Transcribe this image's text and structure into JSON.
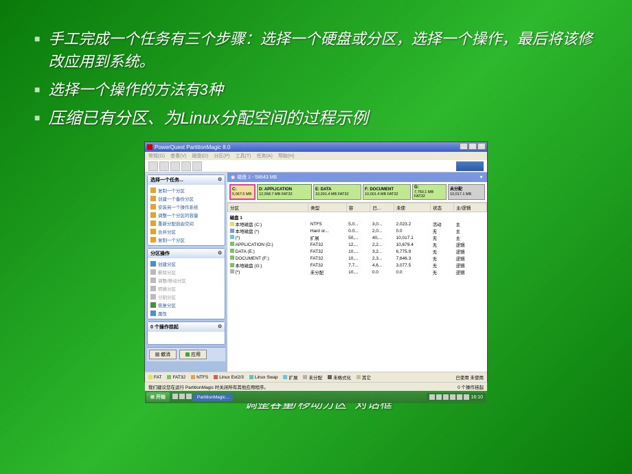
{
  "bullets": [
    "手工完成一个任务有三个步骤：选择一个硬盘或分区，选择一个操作，最后将该修改应用到系统。",
    "选择一个操作的方法有3种",
    "压缩已有分区、为Linux分配空间的过程示例"
  ],
  "caption": "\"调整容量/移动分区\" 对话框",
  "app": {
    "title": "PowerQuest PartitionMagic 8.0",
    "menu": [
      "常规(G)",
      "查看(V)",
      "磁盘(D)",
      "分区(P)",
      "工具(T)",
      "任务(A)",
      "帮助(H)"
    ],
    "disk_label": "磁盘 1 - 58643 MB"
  },
  "sidebar": {
    "tasks": {
      "title": "选择一个任务...",
      "items": [
        "复制一个分区",
        "创建一个备份分区",
        "安装另一个操作系统",
        "调整一个分区的容量",
        "重新分配自由空间",
        "合并分区",
        "复制一个分区"
      ]
    },
    "ops": {
      "title": "分区操作",
      "items": [
        {
          "label": "创建分区",
          "enabled": true
        },
        {
          "label": "删除分区",
          "enabled": false
        },
        {
          "label": "调整/移动分区",
          "enabled": false
        },
        {
          "label": "转换分区",
          "enabled": false
        },
        {
          "label": "分割分区",
          "enabled": false
        },
        {
          "label": "恢复分区",
          "enabled": true
        },
        {
          "label": "属性",
          "enabled": true
        }
      ]
    },
    "pending": {
      "title": "0 个操作挂起"
    },
    "buttons": {
      "undo": "撤消",
      "apply": "应用"
    }
  },
  "partitions": [
    {
      "name": "C:",
      "size": "5,067.5 MB",
      "fs": ""
    },
    {
      "name": "D: APPLICATION",
      "size": "12,958.7 MB",
      "fs": "FAT32"
    },
    {
      "name": "E: DATA",
      "size": "10,001.4 MB",
      "fs": "FAT32"
    },
    {
      "name": "F: DOCUMENT",
      "size": "10,001.4 MB",
      "fs": "FAT32"
    },
    {
      "name": "G:",
      "size": "7,750.1 MB",
      "fs": "FAT32"
    },
    {
      "name": "未分配",
      "size": "10,017.1 MB",
      "fs": ""
    }
  ],
  "table": {
    "headers": [
      "分区",
      "类型",
      "容",
      "已...",
      "未使",
      "状态",
      "主/逻辑"
    ],
    "disk": "磁盘 1",
    "rows": [
      {
        "name": "本地磁盘 (C:)",
        "type": "NTFS",
        "c1": "5,0...",
        "c2": "3,0...",
        "unused": "2,023.2",
        "status": "活动",
        "pl": "主",
        "color": "#e0e060"
      },
      {
        "name": "本地磁盘 (*)",
        "type": "Hard or...",
        "c1": "0.0...",
        "c2": "2,0...",
        "unused": "0.0",
        "status": "无",
        "pl": "主",
        "color": "#70a0d0"
      },
      {
        "name": "(*)",
        "type": "扩展",
        "c1": "50,...",
        "c2": "40,...",
        "unused": "10,017.1",
        "status": "无",
        "pl": "主",
        "color": "#70c0e0"
      },
      {
        "name": "APPLICATION (D:)",
        "type": "FAT32",
        "c1": "12,...",
        "c2": "2,2...",
        "unused": "10,679.4",
        "status": "无",
        "pl": "逻辑",
        "color": "#80c060"
      },
      {
        "name": "DATA (E:)",
        "type": "FAT32",
        "c1": "10,...",
        "c2": "3,2...",
        "unused": "6,775.9",
        "status": "无",
        "pl": "逻辑",
        "color": "#80c060"
      },
      {
        "name": "DOCUMENT (F:)",
        "type": "FAT32",
        "c1": "10,...",
        "c2": "2,3...",
        "unused": "7,646.3",
        "status": "无",
        "pl": "逻辑",
        "color": "#80c060"
      },
      {
        "name": "本地磁盘 (G:)",
        "type": "FAT32",
        "c1": "7,7...",
        "c2": "4,6...",
        "unused": "3,077.5",
        "status": "无",
        "pl": "逻辑",
        "color": "#80c060"
      },
      {
        "name": "(*)",
        "type": "未分配",
        "c1": "10,...",
        "c2": "0.0",
        "unused": "0.0",
        "status": "无",
        "pl": "逻辑",
        "color": "#b0b0b0"
      }
    ]
  },
  "legend": {
    "items": [
      {
        "label": "FAT",
        "color": "#e0e060"
      },
      {
        "label": "FAT32",
        "color": "#80c060"
      },
      {
        "label": "NTFS",
        "color": "#e0a060"
      },
      {
        "label": "Linux Ext2/3",
        "color": "#d06060"
      },
      {
        "label": "Linux Swap",
        "color": "#60c0c0"
      },
      {
        "label": "扩展",
        "color": "#70c0e0"
      },
      {
        "label": "未分配",
        "color": "#b0b0b0"
      },
      {
        "label": "未格式化",
        "color": "#606060"
      },
      {
        "label": "其它",
        "color": "#c0c0a0"
      }
    ],
    "right": "已使用  未使用"
  },
  "status": {
    "left": "我们建议您在运行 PartitionMagic 时关闭所有其他应用程序。",
    "right": "0 个操作挂起"
  },
  "taskbar": {
    "start": "开始",
    "task": "PartitionMagic...",
    "time": "16:10"
  }
}
